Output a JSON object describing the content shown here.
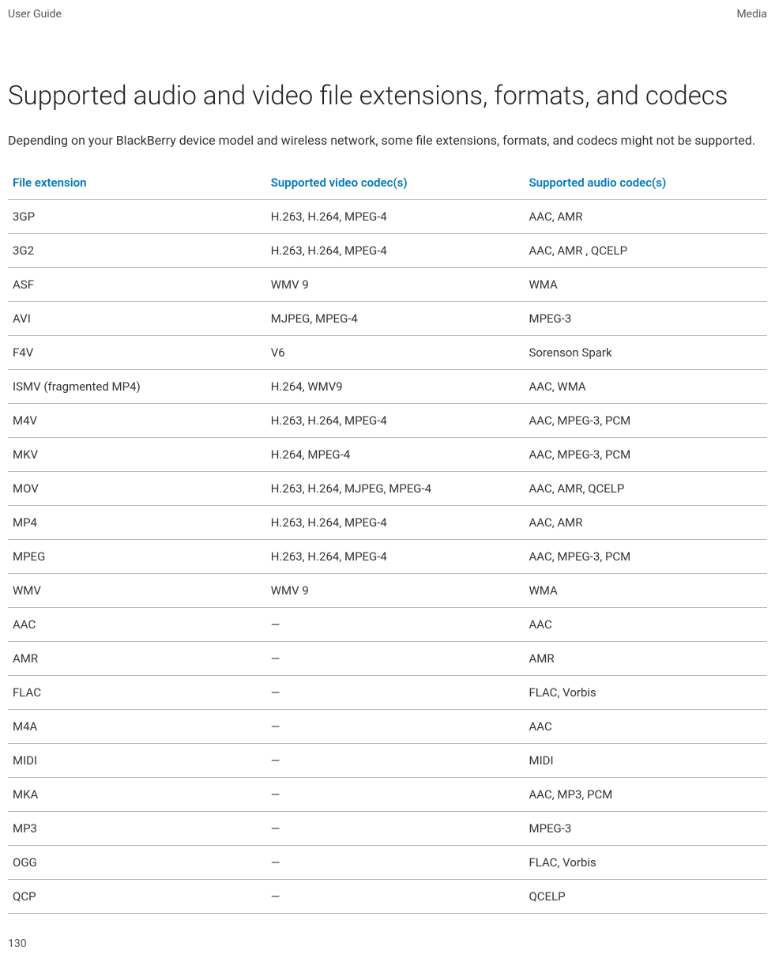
{
  "header": {
    "left": "User Guide",
    "right": "Media"
  },
  "title": "Supported audio and video file extensions, formats, and codecs",
  "intro": "Depending on your BlackBerry device model and wireless network, some file extensions, formats, and codecs might not be supported.",
  "table": {
    "headers": {
      "ext": "File extension",
      "video": "Supported video codec(s)",
      "audio": "Supported audio codec(s)"
    },
    "rows": [
      {
        "ext": "3GP",
        "video": "H.263, H.264, MPEG-4",
        "audio": "AAC, AMR"
      },
      {
        "ext": "3G2",
        "video": "H.263, H.264, MPEG-4",
        "audio": "AAC, AMR , QCELP"
      },
      {
        "ext": "ASF",
        "video": "WMV 9",
        "audio": "WMA"
      },
      {
        "ext": "AVI",
        "video": "MJPEG, MPEG-4",
        "audio": "MPEG-3"
      },
      {
        "ext": "F4V",
        "video": "V6",
        "audio": "Sorenson Spark"
      },
      {
        "ext": "ISMV (fragmented MP4)",
        "video": "H.264, WMV9",
        "audio": "AAC, WMA"
      },
      {
        "ext": "M4V",
        "video": "H.263, H.264, MPEG-4",
        "audio": "AAC, MPEG-3, PCM"
      },
      {
        "ext": "MKV",
        "video": "H.264, MPEG-4",
        "audio": "AAC, MPEG-3, PCM"
      },
      {
        "ext": "MOV",
        "video": "H.263, H.264, MJPEG, MPEG-4",
        "audio": "AAC, AMR, QCELP"
      },
      {
        "ext": "MP4",
        "video": "H.263, H.264, MPEG-4",
        "audio": "AAC, AMR"
      },
      {
        "ext": "MPEG",
        "video": "H.263, H.264, MPEG-4",
        "audio": "AAC, MPEG-3, PCM"
      },
      {
        "ext": "WMV",
        "video": "WMV 9",
        "audio": "WMA"
      },
      {
        "ext": "AAC",
        "video": "—",
        "audio": "AAC"
      },
      {
        "ext": "AMR",
        "video": "—",
        "audio": "AMR"
      },
      {
        "ext": "FLAC",
        "video": "—",
        "audio": "FLAC, Vorbis"
      },
      {
        "ext": "M4A",
        "video": "—",
        "audio": "AAC"
      },
      {
        "ext": "MIDI",
        "video": "—",
        "audio": "MIDI"
      },
      {
        "ext": "MKA",
        "video": "—",
        "audio": "AAC, MP3, PCM"
      },
      {
        "ext": "MP3",
        "video": "—",
        "audio": "MPEG-3"
      },
      {
        "ext": "OGG",
        "video": "—",
        "audio": "FLAC, Vorbis"
      },
      {
        "ext": "QCP",
        "video": "—",
        "audio": "QCELP"
      }
    ]
  },
  "page_number": "130"
}
